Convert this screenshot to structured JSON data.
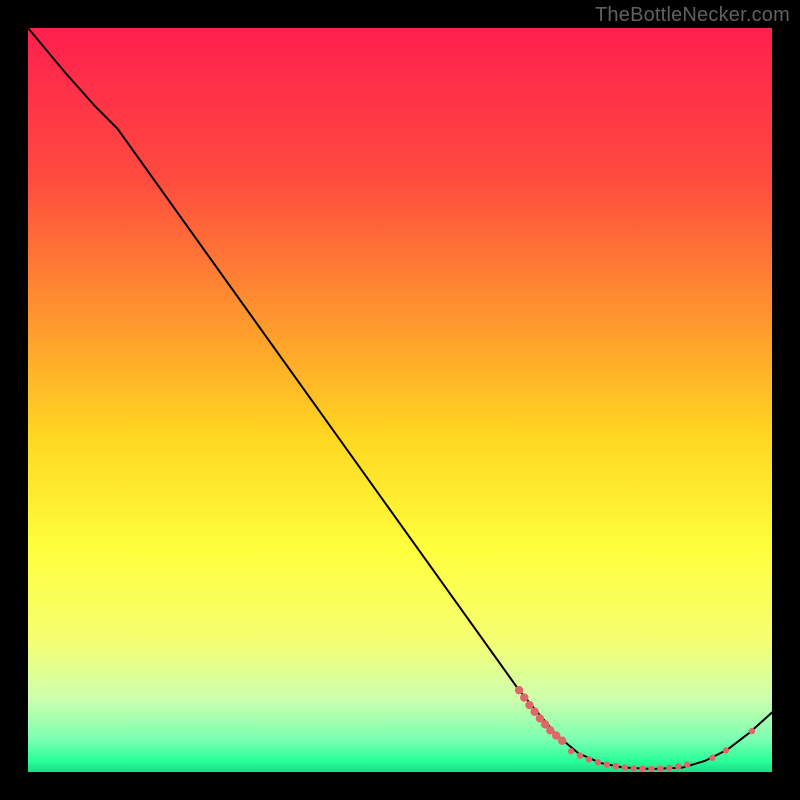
{
  "watermark": "TheBottleNecker.com",
  "chart_data": {
    "type": "line",
    "title": "",
    "xlabel": "",
    "ylabel": "",
    "xlim": [
      0,
      100
    ],
    "ylim": [
      0,
      100
    ],
    "gradient_stops": [
      {
        "offset": 0.0,
        "color": "#ff1f4e"
      },
      {
        "offset": 0.2,
        "color": "#ff4a3f"
      },
      {
        "offset": 0.4,
        "color": "#ff9a2d"
      },
      {
        "offset": 0.55,
        "color": "#ffd721"
      },
      {
        "offset": 0.7,
        "color": "#ffff3c"
      },
      {
        "offset": 0.82,
        "color": "#f6ff70"
      },
      {
        "offset": 0.9,
        "color": "#cfffad"
      },
      {
        "offset": 0.955,
        "color": "#7dffb1"
      },
      {
        "offset": 0.985,
        "color": "#2aff9a"
      },
      {
        "offset": 1.0,
        "color": "#18dd85"
      }
    ],
    "series": [
      {
        "name": "curve",
        "stroke": "#000000",
        "points": [
          {
            "x": 0.0,
            "y": 100.0
          },
          {
            "x": 5.0,
            "y": 94.0
          },
          {
            "x": 9.0,
            "y": 89.5
          },
          {
            "x": 12.0,
            "y": 86.5
          },
          {
            "x": 66.0,
            "y": 11.0
          },
          {
            "x": 71.0,
            "y": 5.0
          },
          {
            "x": 74.0,
            "y": 2.5
          },
          {
            "x": 77.0,
            "y": 1.2
          },
          {
            "x": 80.0,
            "y": 0.6
          },
          {
            "x": 84.0,
            "y": 0.4
          },
          {
            "x": 88.0,
            "y": 0.6
          },
          {
            "x": 91.0,
            "y": 1.5
          },
          {
            "x": 94.0,
            "y": 3.0
          },
          {
            "x": 97.0,
            "y": 5.3
          },
          {
            "x": 100.0,
            "y": 8.0
          }
        ]
      }
    ],
    "markers": {
      "color": "#e06767",
      "radius_small": 3.2,
      "radius_large": 4.2,
      "cluster_left": [
        {
          "x": 66.0,
          "y": 11.0,
          "r": "large"
        },
        {
          "x": 66.7,
          "y": 10.0,
          "r": "large"
        },
        {
          "x": 67.4,
          "y": 9.0,
          "r": "large"
        },
        {
          "x": 68.1,
          "y": 8.1,
          "r": "large"
        },
        {
          "x": 68.8,
          "y": 7.2,
          "r": "large"
        },
        {
          "x": 69.5,
          "y": 6.4,
          "r": "large"
        },
        {
          "x": 70.2,
          "y": 5.6,
          "r": "large"
        },
        {
          "x": 71.0,
          "y": 4.9,
          "r": "large"
        },
        {
          "x": 71.8,
          "y": 4.2,
          "r": "large"
        }
      ],
      "bottom_row": [
        {
          "x": 73.0,
          "y": 2.8
        },
        {
          "x": 74.2,
          "y": 2.2
        },
        {
          "x": 75.4,
          "y": 1.7
        },
        {
          "x": 76.6,
          "y": 1.3
        },
        {
          "x": 77.8,
          "y": 1.0
        },
        {
          "x": 79.0,
          "y": 0.8
        },
        {
          "x": 80.2,
          "y": 0.6
        },
        {
          "x": 81.4,
          "y": 0.5
        },
        {
          "x": 82.6,
          "y": 0.45
        },
        {
          "x": 83.8,
          "y": 0.4
        },
        {
          "x": 85.0,
          "y": 0.45
        },
        {
          "x": 86.2,
          "y": 0.55
        },
        {
          "x": 87.4,
          "y": 0.75
        },
        {
          "x": 88.6,
          "y": 1.0
        }
      ],
      "right_pair": [
        {
          "x": 92.0,
          "y": 1.9
        },
        {
          "x": 93.8,
          "y": 2.9
        }
      ],
      "top_right": [
        {
          "x": 97.3,
          "y": 5.5
        }
      ]
    }
  }
}
